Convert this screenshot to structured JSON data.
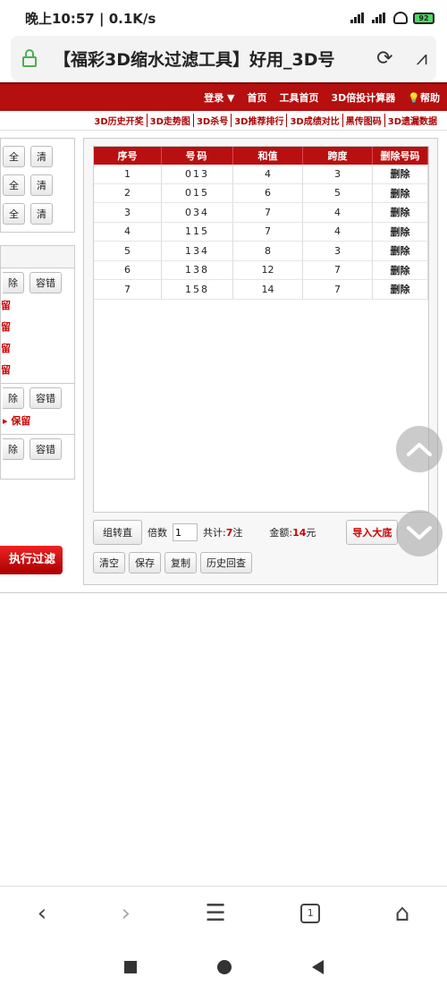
{
  "status_bar": {
    "time": "晚上10:57",
    "speed": "0.1K/s",
    "battery": "92"
  },
  "address_bar": {
    "title": "【福彩3D缩水过滤工具】好用_3D号"
  },
  "top_nav": {
    "items": [
      "登录 ▼",
      "首页",
      "工具首页",
      "3D倍投计算器",
      "帮助"
    ]
  },
  "sub_nav": {
    "items": [
      "3D历史开奖",
      "3D走势图",
      "3D杀号",
      "3D推荐排行",
      "3D成绩对比",
      "黑传图码",
      "3D遗漏数据"
    ]
  },
  "left_panel": {
    "all_label": "全",
    "clear_label": "清",
    "remove_label": "除",
    "tolerance_label": "容错",
    "keep_short": "留",
    "keep_label": "保留",
    "execute_label": "执行过滤"
  },
  "table": {
    "headers": [
      "序号",
      "号码",
      "和值",
      "跨度",
      "删除号码"
    ],
    "rows": [
      {
        "no": "1",
        "num": "013",
        "sum": "4",
        "span": "3",
        "del": "删除"
      },
      {
        "no": "2",
        "num": "015",
        "sum": "6",
        "span": "5",
        "del": "删除"
      },
      {
        "no": "3",
        "num": "034",
        "sum": "7",
        "span": "4",
        "del": "删除"
      },
      {
        "no": "4",
        "num": "115",
        "sum": "7",
        "span": "4",
        "del": "删除"
      },
      {
        "no": "5",
        "num": "134",
        "sum": "8",
        "span": "3",
        "del": "删除"
      },
      {
        "no": "6",
        "num": "138",
        "sum": "12",
        "span": "7",
        "del": "删除"
      },
      {
        "no": "7",
        "num": "158",
        "sum": "14",
        "span": "7",
        "del": "删除"
      }
    ]
  },
  "summary": {
    "group_label": "组转直",
    "mult_label": "倍数",
    "mult_value": "1",
    "total_label": "共计:",
    "total_value": "7",
    "total_unit": "注",
    "amount_label": "金额:",
    "amount_value": "14",
    "amount_unit": "元",
    "import_label": "导入大底"
  },
  "actions": [
    "清空",
    "保存",
    "复制",
    "历史回查"
  ],
  "browser_nav": {
    "tab_count": "1"
  }
}
